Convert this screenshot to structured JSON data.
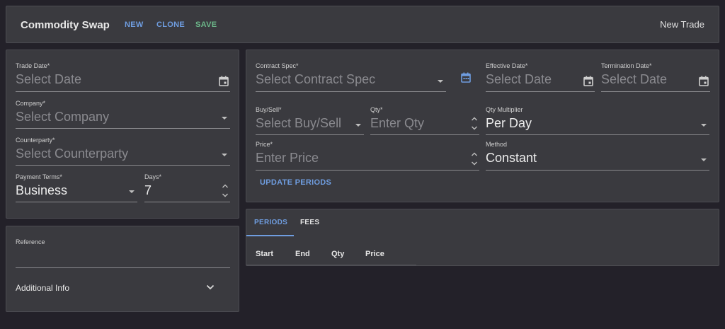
{
  "header": {
    "title": "Commodity Swap",
    "new_label": "NEW",
    "clone_label": "CLONE",
    "save_label": "SAVE",
    "right_label": "New Trade"
  },
  "left": {
    "trade_date": {
      "label": "Trade Date*",
      "placeholder": "Select Date"
    },
    "company": {
      "label": "Company*",
      "placeholder": "Select Company"
    },
    "counterparty": {
      "label": "Counterparty*",
      "placeholder": "Select Counterparty"
    },
    "payment_terms": {
      "label": "Payment Terms*",
      "value": "Business"
    },
    "days": {
      "label": "Days*",
      "value": "7"
    }
  },
  "reference": {
    "label": "Reference",
    "additional_info": "Additional Info"
  },
  "contract": {
    "contract_spec": {
      "label": "Contract Spec*",
      "placeholder": "Select Contract Spec"
    },
    "effective_date": {
      "label": "Effective Date*",
      "placeholder": "Select Date"
    },
    "termination_date": {
      "label": "Termination Date*",
      "placeholder": "Select Date"
    },
    "buy_sell": {
      "label": "Buy/Sell*",
      "placeholder": "Select Buy/Sell"
    },
    "qty": {
      "label": "Qty*",
      "placeholder": "Enter Qty"
    },
    "qty_multiplier": {
      "label": "Qty Multiplier",
      "value": "Per Day"
    },
    "price": {
      "label": "Price*",
      "placeholder": "Enter Price"
    },
    "method": {
      "label": "Method",
      "value": "Constant"
    },
    "update_periods_label": "UPDATE PERIODS"
  },
  "periods": {
    "tabs": [
      "PERIODS",
      "FEES"
    ],
    "columns": [
      "Start",
      "End",
      "Qty",
      "Price"
    ]
  },
  "colors": {
    "accent_blue": "#6f9de0",
    "save_green": "#6cb88a",
    "panel": "#3a3a3f",
    "background": "#232129"
  }
}
